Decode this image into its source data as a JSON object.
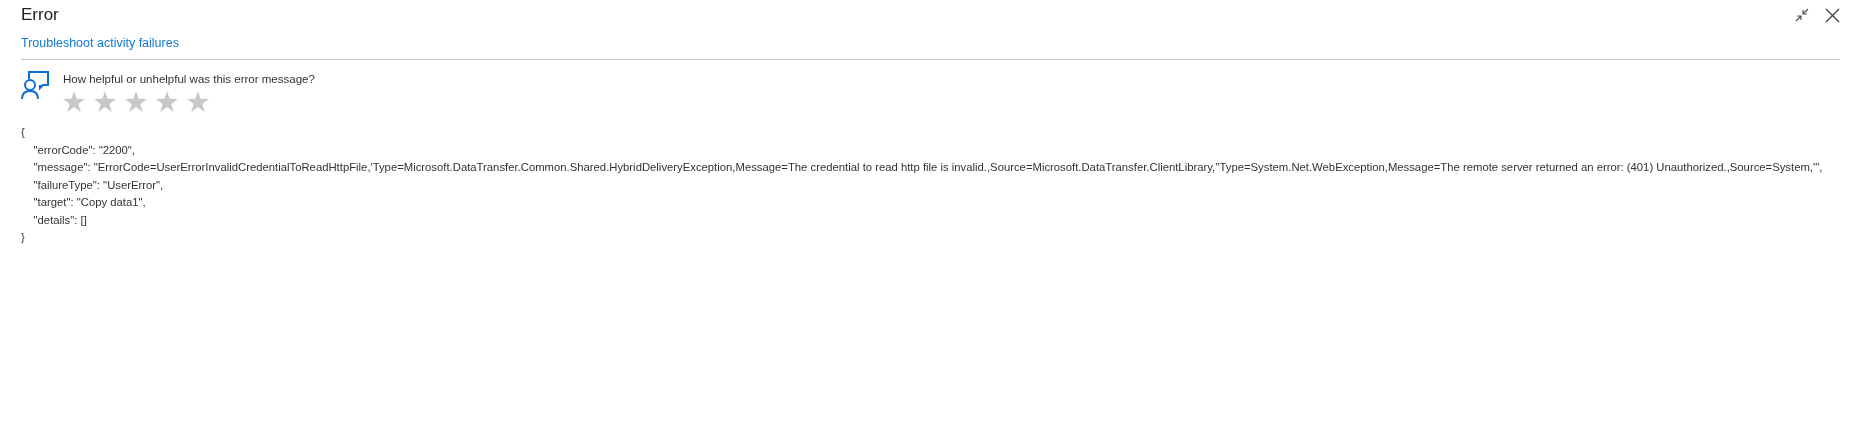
{
  "panel": {
    "title": "Error",
    "link": "Troubleshoot activity failures"
  },
  "feedback": {
    "question": "How helpful or unhelpful was this error message?",
    "stars": 0
  },
  "error_json": [
    "{",
    "    \"errorCode\": \"2200\",",
    "    \"message\": \"ErrorCode=UserErrorInvalidCredentialToReadHttpFile,'Type=Microsoft.DataTransfer.Common.Shared.HybridDeliveryException,Message=The credential to read http file is invalid.,Source=Microsoft.DataTransfer.ClientLibrary,''Type=System.Net.WebException,Message=The remote server returned an error: (401) Unauthorized.,Source=System,'\",",
    "    \"failureType\": \"UserError\",",
    "    \"target\": \"Copy data1\",",
    "    \"details\": []",
    "}"
  ]
}
